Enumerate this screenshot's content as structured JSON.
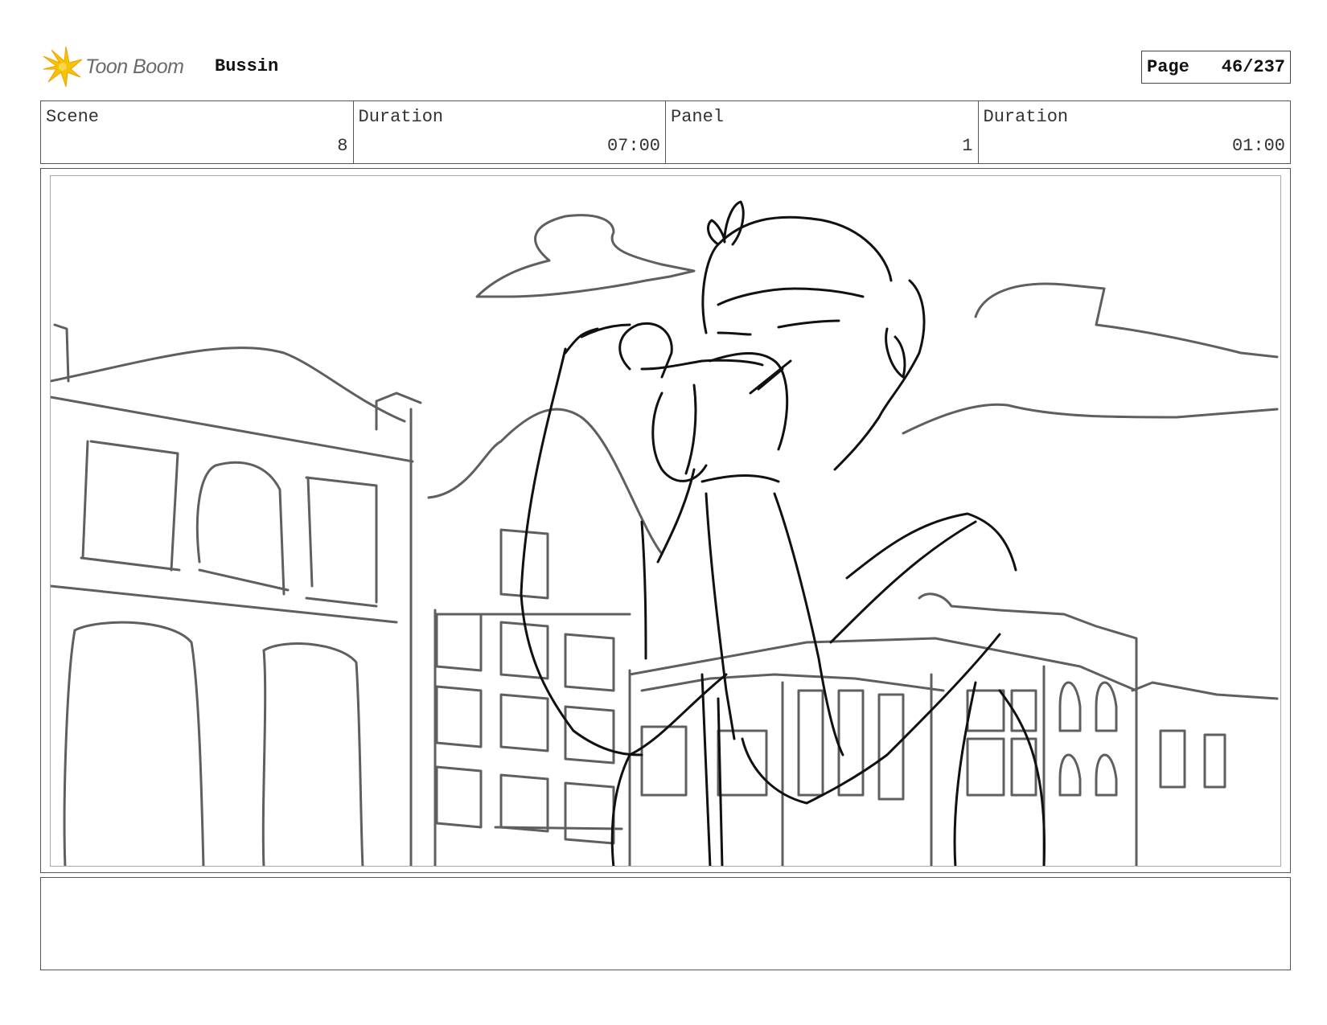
{
  "header": {
    "logo_text": "Toon Boom",
    "project_name": "Bussin",
    "page_label": "Page",
    "page_value": "46/237"
  },
  "info": {
    "scene_label": "Scene",
    "scene_value": "8",
    "scene_duration_label": "Duration",
    "scene_duration_value": "07:00",
    "panel_label": "Panel",
    "panel_value": "1",
    "panel_duration_label": "Duration",
    "panel_duration_value": "01:00"
  },
  "panel": {
    "image_icon": "storyboard-sketch"
  },
  "notes": {
    "text": ""
  },
  "colors": {
    "logo_yellow": "#f5c400",
    "logo_orange": "#f0a000",
    "sketch_gray": "#5f5f5f",
    "sketch_black": "#111111"
  }
}
